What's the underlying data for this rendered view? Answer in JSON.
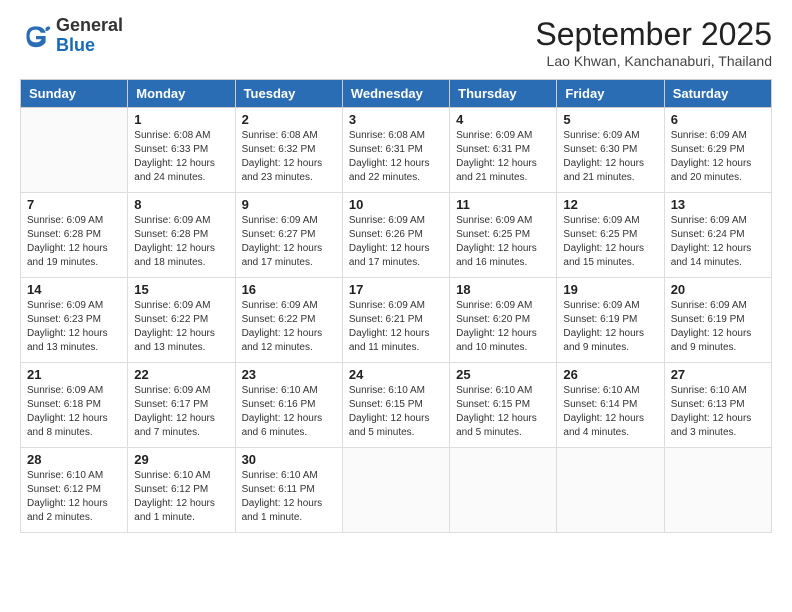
{
  "header": {
    "logo": {
      "general": "General",
      "blue": "Blue"
    },
    "title": "September 2025",
    "location": "Lao Khwan, Kanchanaburi, Thailand"
  },
  "calendar": {
    "weekdays": [
      "Sunday",
      "Monday",
      "Tuesday",
      "Wednesday",
      "Thursday",
      "Friday",
      "Saturday"
    ],
    "weeks": [
      [
        {
          "day": "",
          "info": ""
        },
        {
          "day": "1",
          "info": "Sunrise: 6:08 AM\nSunset: 6:33 PM\nDaylight: 12 hours\nand 24 minutes."
        },
        {
          "day": "2",
          "info": "Sunrise: 6:08 AM\nSunset: 6:32 PM\nDaylight: 12 hours\nand 23 minutes."
        },
        {
          "day": "3",
          "info": "Sunrise: 6:08 AM\nSunset: 6:31 PM\nDaylight: 12 hours\nand 22 minutes."
        },
        {
          "day": "4",
          "info": "Sunrise: 6:09 AM\nSunset: 6:31 PM\nDaylight: 12 hours\nand 21 minutes."
        },
        {
          "day": "5",
          "info": "Sunrise: 6:09 AM\nSunset: 6:30 PM\nDaylight: 12 hours\nand 21 minutes."
        },
        {
          "day": "6",
          "info": "Sunrise: 6:09 AM\nSunset: 6:29 PM\nDaylight: 12 hours\nand 20 minutes."
        }
      ],
      [
        {
          "day": "7",
          "info": "Sunrise: 6:09 AM\nSunset: 6:28 PM\nDaylight: 12 hours\nand 19 minutes."
        },
        {
          "day": "8",
          "info": "Sunrise: 6:09 AM\nSunset: 6:28 PM\nDaylight: 12 hours\nand 18 minutes."
        },
        {
          "day": "9",
          "info": "Sunrise: 6:09 AM\nSunset: 6:27 PM\nDaylight: 12 hours\nand 17 minutes."
        },
        {
          "day": "10",
          "info": "Sunrise: 6:09 AM\nSunset: 6:26 PM\nDaylight: 12 hours\nand 17 minutes."
        },
        {
          "day": "11",
          "info": "Sunrise: 6:09 AM\nSunset: 6:25 PM\nDaylight: 12 hours\nand 16 minutes."
        },
        {
          "day": "12",
          "info": "Sunrise: 6:09 AM\nSunset: 6:25 PM\nDaylight: 12 hours\nand 15 minutes."
        },
        {
          "day": "13",
          "info": "Sunrise: 6:09 AM\nSunset: 6:24 PM\nDaylight: 12 hours\nand 14 minutes."
        }
      ],
      [
        {
          "day": "14",
          "info": "Sunrise: 6:09 AM\nSunset: 6:23 PM\nDaylight: 12 hours\nand 13 minutes."
        },
        {
          "day": "15",
          "info": "Sunrise: 6:09 AM\nSunset: 6:22 PM\nDaylight: 12 hours\nand 13 minutes."
        },
        {
          "day": "16",
          "info": "Sunrise: 6:09 AM\nSunset: 6:22 PM\nDaylight: 12 hours\nand 12 minutes."
        },
        {
          "day": "17",
          "info": "Sunrise: 6:09 AM\nSunset: 6:21 PM\nDaylight: 12 hours\nand 11 minutes."
        },
        {
          "day": "18",
          "info": "Sunrise: 6:09 AM\nSunset: 6:20 PM\nDaylight: 12 hours\nand 10 minutes."
        },
        {
          "day": "19",
          "info": "Sunrise: 6:09 AM\nSunset: 6:19 PM\nDaylight: 12 hours\nand 9 minutes."
        },
        {
          "day": "20",
          "info": "Sunrise: 6:09 AM\nSunset: 6:19 PM\nDaylight: 12 hours\nand 9 minutes."
        }
      ],
      [
        {
          "day": "21",
          "info": "Sunrise: 6:09 AM\nSunset: 6:18 PM\nDaylight: 12 hours\nand 8 minutes."
        },
        {
          "day": "22",
          "info": "Sunrise: 6:09 AM\nSunset: 6:17 PM\nDaylight: 12 hours\nand 7 minutes."
        },
        {
          "day": "23",
          "info": "Sunrise: 6:10 AM\nSunset: 6:16 PM\nDaylight: 12 hours\nand 6 minutes."
        },
        {
          "day": "24",
          "info": "Sunrise: 6:10 AM\nSunset: 6:15 PM\nDaylight: 12 hours\nand 5 minutes."
        },
        {
          "day": "25",
          "info": "Sunrise: 6:10 AM\nSunset: 6:15 PM\nDaylight: 12 hours\nand 5 minutes."
        },
        {
          "day": "26",
          "info": "Sunrise: 6:10 AM\nSunset: 6:14 PM\nDaylight: 12 hours\nand 4 minutes."
        },
        {
          "day": "27",
          "info": "Sunrise: 6:10 AM\nSunset: 6:13 PM\nDaylight: 12 hours\nand 3 minutes."
        }
      ],
      [
        {
          "day": "28",
          "info": "Sunrise: 6:10 AM\nSunset: 6:12 PM\nDaylight: 12 hours\nand 2 minutes."
        },
        {
          "day": "29",
          "info": "Sunrise: 6:10 AM\nSunset: 6:12 PM\nDaylight: 12 hours\nand 1 minute."
        },
        {
          "day": "30",
          "info": "Sunrise: 6:10 AM\nSunset: 6:11 PM\nDaylight: 12 hours\nand 1 minute."
        },
        {
          "day": "",
          "info": ""
        },
        {
          "day": "",
          "info": ""
        },
        {
          "day": "",
          "info": ""
        },
        {
          "day": "",
          "info": ""
        }
      ]
    ]
  }
}
